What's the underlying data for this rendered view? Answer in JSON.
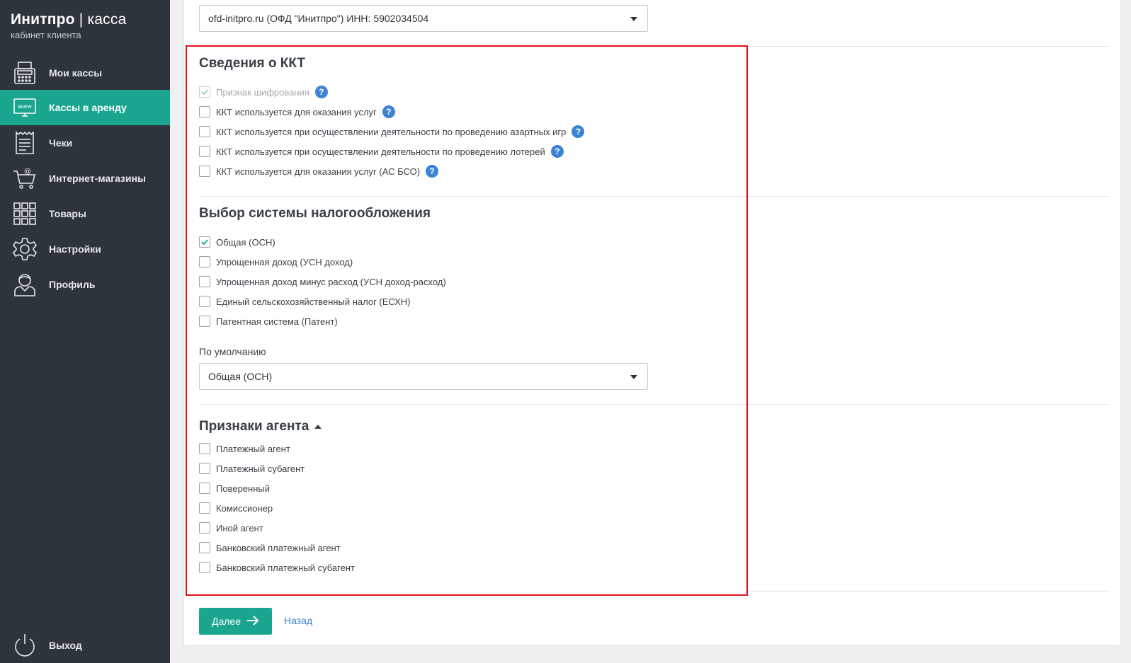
{
  "brand": {
    "name": "Инитпро",
    "separator": " | ",
    "product": "касса",
    "subtitle": "кабинет клиента"
  },
  "sidebar": {
    "items": [
      {
        "label": "Мои кассы",
        "icon": "cash-register-icon",
        "active": false
      },
      {
        "label": "Кассы в аренду",
        "icon": "www-monitor-icon",
        "active": true
      },
      {
        "label": "Чеки",
        "icon": "receipt-icon",
        "active": false
      },
      {
        "label": "Интернет-магазины",
        "icon": "shopping-cart-icon",
        "active": false
      },
      {
        "label": "Товары",
        "icon": "grid-icon",
        "active": false
      },
      {
        "label": "Настройки",
        "icon": "gear-icon",
        "active": false
      },
      {
        "label": "Профиль",
        "icon": "user-icon",
        "active": false
      }
    ],
    "logout_label": "Выход"
  },
  "ofd_select": {
    "value": "ofd-initpro.ru (ОФД \"Инитпро\") ИНН: 5902034504"
  },
  "kkt_section": {
    "title": "Сведения о ККТ",
    "options": [
      {
        "label": "Признак шифрования",
        "checked": true,
        "disabled": true,
        "help": true
      },
      {
        "label": "ККТ используется для оказания услуг",
        "checked": false,
        "disabled": false,
        "help": true
      },
      {
        "label": "ККТ используется при осуществлении деятельности по проведению азартных игр",
        "checked": false,
        "disabled": false,
        "help": true
      },
      {
        "label": "ККТ используется при осуществлении деятельности по проведению лотерей",
        "checked": false,
        "disabled": false,
        "help": true
      },
      {
        "label": "ККТ используется для оказания услуг (АС БСО)",
        "checked": false,
        "disabled": false,
        "help": true
      }
    ],
    "help_symbol": "?"
  },
  "tax_section": {
    "title": "Выбор системы налогообложения",
    "options": [
      {
        "label": "Общая (ОСН)",
        "checked": true
      },
      {
        "label": "Упрощенная доход (УСН доход)",
        "checked": false
      },
      {
        "label": "Упрощенная доход минус расход (УСН доход-расход)",
        "checked": false
      },
      {
        "label": "Единый сельскохозяйственный налог (ЕСХН)",
        "checked": false
      },
      {
        "label": "Патентная система (Патент)",
        "checked": false
      }
    ],
    "default_label": "По умолчанию",
    "default_value": "Общая (ОСН)"
  },
  "agent_section": {
    "title": "Признаки агента",
    "options": [
      {
        "label": "Платежный агент",
        "checked": false
      },
      {
        "label": "Платежный субагент",
        "checked": false
      },
      {
        "label": "Поверенный",
        "checked": false
      },
      {
        "label": "Комиссионер",
        "checked": false
      },
      {
        "label": "Иной агент",
        "checked": false
      },
      {
        "label": "Банковский платежный агент",
        "checked": false
      },
      {
        "label": "Банковский платежный субагент",
        "checked": false
      }
    ]
  },
  "actions": {
    "next_label": "Далее",
    "back_label": "Назад"
  },
  "colors": {
    "accent": "#1aa58f",
    "sidebar_bg": "#2e343c",
    "link": "#3d84d6",
    "highlight_border": "#e0111c"
  }
}
